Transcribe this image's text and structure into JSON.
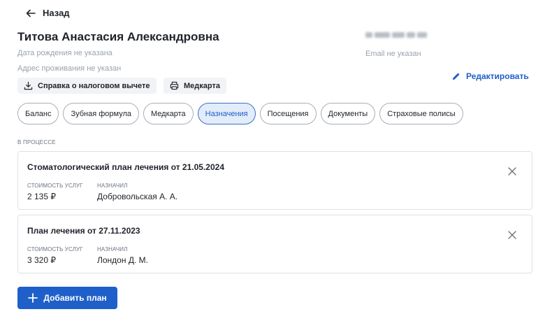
{
  "nav": {
    "back_label": "Назад"
  },
  "patient": {
    "name": "Титова Анастасия Александровна",
    "birth_date": "Дата рождения не указана",
    "address": "Адрес проживания не указан",
    "email": "Email не указан"
  },
  "actions": {
    "edit_label": "Редактировать",
    "tax_label": "Справка о налоговом вычете",
    "medcard_label": "Медкарта"
  },
  "tabs": [
    {
      "label": "Баланс",
      "active": false
    },
    {
      "label": "Зубная формула",
      "active": false
    },
    {
      "label": "Медкарта",
      "active": false
    },
    {
      "label": "Назначения",
      "active": true
    },
    {
      "label": "Посещения",
      "active": false
    },
    {
      "label": "Документы",
      "active": false
    },
    {
      "label": "Страховые полисы",
      "active": false
    }
  ],
  "section": {
    "label": "В ПРОЦЕССЕ"
  },
  "plans": [
    {
      "title": "Стоматологический план лечения от 21.05.2024",
      "cost_label": "СТОИМОСТЬ УСЛУГ",
      "cost": "2 135 ₽",
      "assigned_label": "НАЗНАЧИЛ",
      "assigned": "Добровольская А. А."
    },
    {
      "title": "План лечения от 27.11.2023",
      "cost_label": "СТОИМОСТЬ УСЛУГ",
      "cost": "3 320 ₽",
      "assigned_label": "НАЗНАЧИЛ",
      "assigned": "Лондон Д. М."
    }
  ],
  "add_plan": {
    "label": "Добавить план"
  },
  "colors": {
    "accent": "#1f5fc9",
    "active_tab_bg": "#e3ecfa",
    "muted_text": "#9aa3ae"
  }
}
